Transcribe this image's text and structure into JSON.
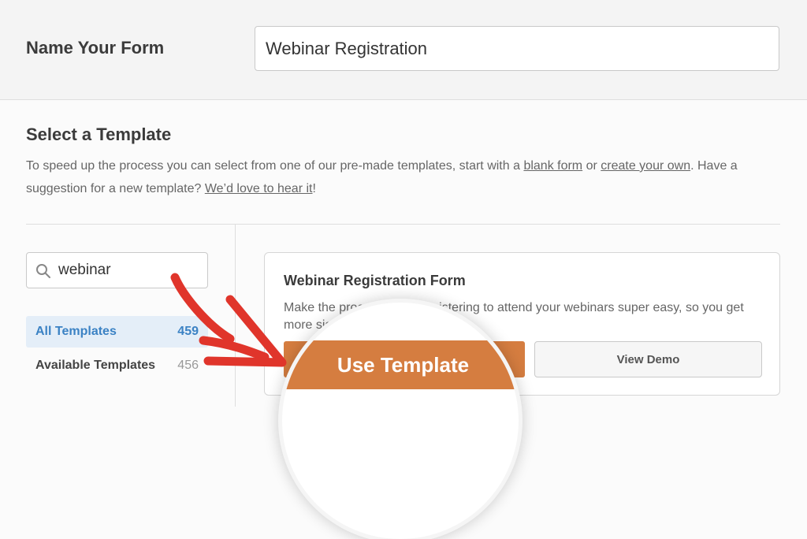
{
  "header": {
    "label": "Name Your Form",
    "form_name_value": "Webinar Registration"
  },
  "section": {
    "title": "Select a Template",
    "desc_part1": "To speed up the process you can select from one of our pre-made templates, start with a ",
    "link_blank": "blank form",
    "desc_part2": " or ",
    "link_create": "create your own",
    "desc_part3": ". Have a suggestion for a new template? ",
    "link_love": "We’d love to hear it",
    "desc_part4": "!"
  },
  "sidebar": {
    "search_value": "webinar",
    "categories": [
      {
        "label": "All Templates",
        "count": "459"
      },
      {
        "label": "Available Templates",
        "count": "456"
      }
    ]
  },
  "template": {
    "title": "Webinar Registration Form",
    "description_visible_start": "Make the proces",
    "description_visible_end": "gistering to attend your webinars super easy, so you get",
    "description_line2": "more sig",
    "use_button": "Use Template",
    "demo_button": "View Demo"
  },
  "colors": {
    "accent_orange": "#d57d40",
    "annotation_red": "#e0352b",
    "active_blue": "#3b82c4"
  }
}
